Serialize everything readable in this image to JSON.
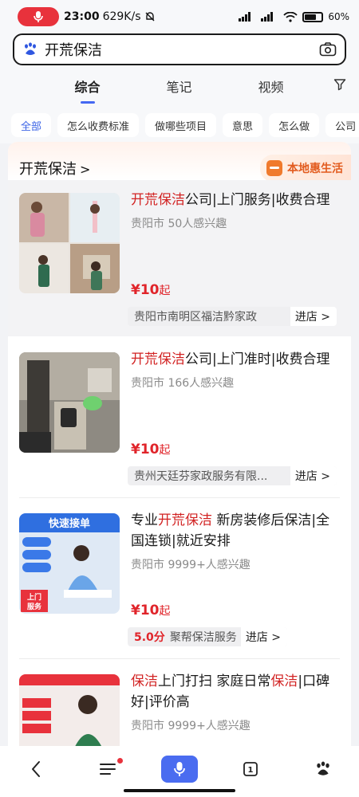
{
  "status_bar": {
    "time": "23:00",
    "speed": "629K/s",
    "battery": "60%"
  },
  "search": {
    "query": "开荒保洁"
  },
  "tabs": [
    {
      "label": "综合",
      "active": true
    },
    {
      "label": "笔记",
      "active": false
    },
    {
      "label": "视频",
      "active": false
    }
  ],
  "chips": [
    {
      "label": "全部",
      "active": true
    },
    {
      "label": "怎么收费标准"
    },
    {
      "label": "做哪些项目"
    },
    {
      "label": "意思"
    },
    {
      "label": "怎么做"
    },
    {
      "label": "公司"
    }
  ],
  "card": {
    "title": "开荒保洁",
    "title_arrow": ">",
    "local_badge": "本地惠生活"
  },
  "results": [
    {
      "title_red": "开荒保洁",
      "title_rest": "公司|上门服务|收费合理",
      "location": "贵阳市 50人感兴趣",
      "price": "¥10",
      "price_suffix": "起",
      "rating": "",
      "shop": "贵阳市南明区福洁黔家政",
      "enter": "进店 >"
    },
    {
      "title_red": "开荒保洁",
      "title_rest": "公司|上门准时|收费合理",
      "location": "贵阳市 166人感兴趣",
      "price": "¥10",
      "price_suffix": "起",
      "rating": "",
      "shop": "贵州天廷芬家政服务有限...",
      "enter": "进店 >"
    },
    {
      "title_prefix": "专业",
      "title_red": "开荒保洁",
      "title_rest": " 新房装修后保洁|全国连锁|就近安排",
      "location": "贵阳市 9999+人感兴趣",
      "price": "¥10",
      "price_suffix": "起",
      "rating": "5.0分",
      "shop": "聚帮保洁服务",
      "enter": "进店 >",
      "thumb_text": {
        "banner": "快速接单",
        "tag1": "上门",
        "tag2": "服务"
      }
    },
    {
      "title_red": "保洁",
      "title_mid": "上门打扫 家庭日常",
      "title_red2": "保洁",
      "title_rest": "|口碑好|评价高",
      "location": "贵阳市 9999+人感兴趣"
    }
  ],
  "colors": {
    "accent": "#4468f2",
    "highlight_red": "#d22323",
    "price_red": "#e0242a",
    "local_orange": "#e25b1e"
  },
  "icons": {
    "search_logo": "paw-icon",
    "camera": "camera-icon",
    "filter": "filter-icon",
    "nav": [
      "back-icon",
      "menu-icon",
      "mic-icon",
      "tabs-icon",
      "paw-icon"
    ]
  },
  "bottom_nav": {
    "tabs_count": "1"
  }
}
